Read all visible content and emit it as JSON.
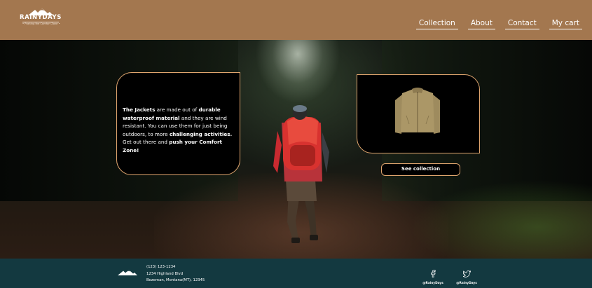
{
  "header": {
    "logo": {
      "name": "RAINYDAYS",
      "tagline": "• Pushing the Comfort Zone •"
    },
    "nav": [
      {
        "label": "Collection"
      },
      {
        "label": "About"
      },
      {
        "label": "Contact"
      },
      {
        "label": "My cart"
      }
    ],
    "background": "#a3774f"
  },
  "hero": {
    "info": {
      "p1": "The Jackets",
      "p2": " are made out of ",
      "p3": "durable waterproof material",
      "p4": " and they are wind resistant. You can use them for just being outdoors, to more ",
      "p5": "challenging activities.",
      "p6": " Get out there and ",
      "p7": "push your Comfort Zone!"
    },
    "see_collection_label": "See collection",
    "accent": "#e0a56e"
  },
  "footer": {
    "phone": "(123) 123-1234",
    "street": "1234 Highland Blvd",
    "city": "Bozeman, Montana(MT), 12345",
    "social": [
      {
        "icon": "facebook-icon",
        "handle": "@RainyDays"
      },
      {
        "icon": "twitter-icon",
        "handle": "@RainyDays"
      }
    ],
    "background": "#133940"
  }
}
